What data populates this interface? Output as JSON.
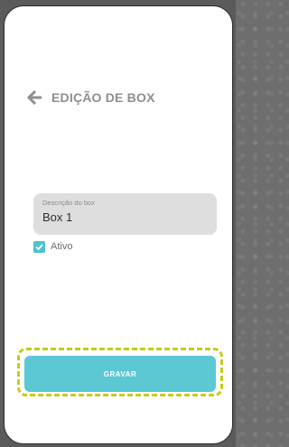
{
  "header": {
    "back_icon": "arrow-left-icon",
    "title": "EDIÇÃO DE BOX"
  },
  "form": {
    "description": {
      "label": "Descrição do box",
      "value": "Box 1"
    },
    "active": {
      "label": "Ativo",
      "checked": true
    },
    "save_label": "GRAVAR"
  },
  "colors": {
    "accent": "#5cc8d3",
    "focus_outline": "#c5cc1e",
    "title": "#8f8f8f",
    "field_background": "#dedede"
  }
}
